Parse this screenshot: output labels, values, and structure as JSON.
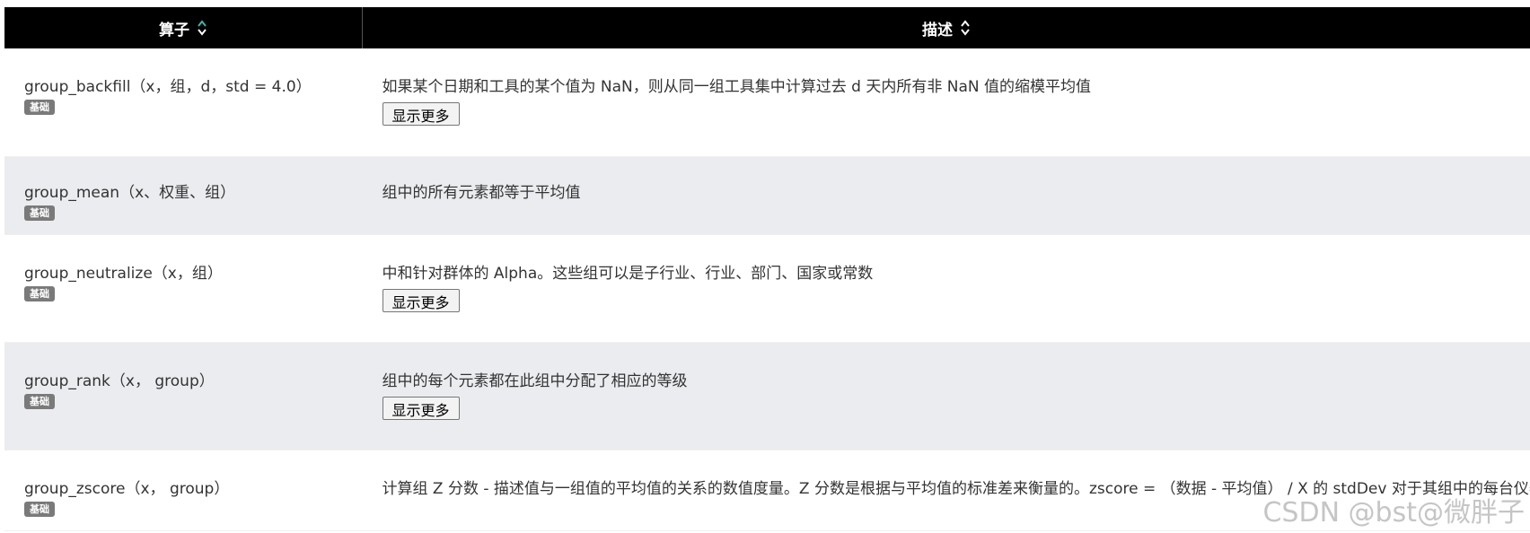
{
  "table": {
    "headers": {
      "operator": "算子",
      "description": "描述"
    },
    "show_more_label": "显示更多",
    "rows": [
      {
        "name": "group_backfill（x，组，d，std = 4.0）",
        "badge": "基础",
        "description": "如果某个日期和工具的某个值为 NaN，则从同一组工具集中计算过去 d 天内所有非 NaN 值的缩模平均值",
        "has_more": true
      },
      {
        "name": "group_mean（x、权重、组）",
        "badge": "基础",
        "description": "组中的所有元素都等于平均值",
        "has_more": false
      },
      {
        "name": "group_neutralize（x，组）",
        "badge": "基础",
        "description": "中和针对群体的 Alpha。这些组可以是子行业、行业、部门、国家或常数",
        "has_more": true
      },
      {
        "name": "group_rank（x， group）",
        "badge": "基础",
        "description": "组中的每个元素都在此组中分配了相应的等级",
        "has_more": true
      },
      {
        "name": "group_zscore（x， group）",
        "badge": "基础",
        "description": "计算组 Z 分数 - 描述值与一组值的平均值的关系的数值度量。Z 分数是根据与平均值的标准差来衡量的。zscore = （数据 - 平均值） / X 的 stdDev 对于其组中的每台仪器。",
        "has_more": false
      }
    ]
  },
  "watermark": "CSDN @bst@微胖子",
  "colors": {
    "header_bg": "#000000",
    "header_text": "#ffffff",
    "alt_row_bg": "#ebecef",
    "badge_bg": "#7a7a7a",
    "sort_active": "#3fb5a5"
  },
  "icons": {
    "sort": "sort-updown-icon"
  }
}
